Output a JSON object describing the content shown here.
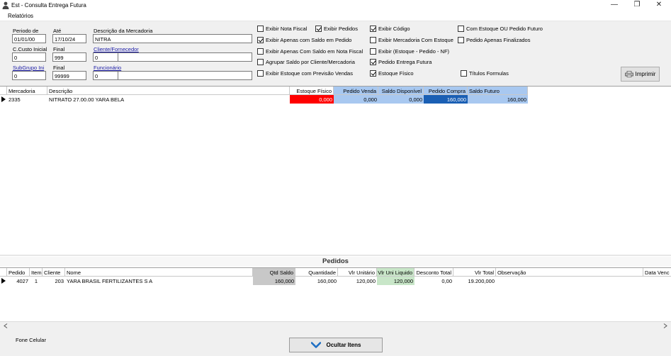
{
  "window": {
    "title": "Est - Consulta Entrega Futura",
    "minimize": "—",
    "restore": "❐",
    "close": "✕"
  },
  "menu": {
    "relatorios": "Relatórios"
  },
  "filters": {
    "periodo_de": {
      "label": "Periodo de",
      "value": "01/01/00"
    },
    "ate": {
      "label": "Até",
      "value": "17/10/24"
    },
    "descricao_mercadoria": {
      "label": "Descrição da Mercadoria",
      "value": "NITRA"
    },
    "ccusto_inicial": {
      "label": "C.Custo Inicial",
      "value": "0"
    },
    "ccusto_final": {
      "label": "Final",
      "value": "999"
    },
    "cliente_fornecedor": {
      "label": "Cliente/Fornecedor",
      "code": "0",
      "name": ""
    },
    "subgrupo_ini": {
      "label": "SubGrupo Ini",
      "value": "0"
    },
    "subgrupo_final": {
      "label": "Final",
      "value": "99999"
    },
    "funcionario": {
      "label": "Funcionário",
      "code": "0",
      "name": ""
    }
  },
  "options": {
    "exibir_nota_fiscal": {
      "label": "Exibir Nota Fiscal",
      "checked": false
    },
    "exibir_pedidos": {
      "label": "Exibir Pedidos",
      "checked": true
    },
    "exibir_codigo": {
      "label": "Exibir Código",
      "checked": true
    },
    "com_estoque_ou_pedido_futuro": {
      "label": "Com Estoque OU Pedido Futuro",
      "checked": false
    },
    "exibir_apenas_saldo_pedido": {
      "label": "Exibir Apenas com Saldo em Pedido",
      "checked": true
    },
    "exibir_mercadoria_com_estoque": {
      "label": "Exibir Mercadoria Com Estoque",
      "checked": false
    },
    "pedido_apenas_finalizados": {
      "label": "Pedido Apenas Finalizados",
      "checked": false
    },
    "exibir_apenas_saldo_nf": {
      "label": "Exibir Apenas Com Saldo em Nota Fiscal",
      "checked": false
    },
    "exibir_estoque_pedido_nf": {
      "label": "Exibir (Estoque - Pedido - NF)",
      "checked": false
    },
    "agrupar_saldo": {
      "label": "Agrupar Saldo por Cliente/Mercadoria",
      "checked": false
    },
    "pedido_entrega_futura": {
      "label": "Pedido Entrega Futura",
      "checked": true
    },
    "exibir_estoque_previsao": {
      "label": "Exibir Estoque com Previsão Vendas",
      "checked": false
    },
    "estoque_fisico": {
      "label": "Estoque Físico",
      "checked": true
    },
    "titulos_formulas": {
      "label": "Títulos Formulas",
      "checked": false
    }
  },
  "buttons": {
    "imprimir": "Imprimir",
    "ocultar_itens": "Ocultar Itens"
  },
  "grid_mercadorias": {
    "headers": {
      "mercadoria": "Mercadoria",
      "descricao": "Descrição",
      "estoque_fisico": "Estoque Físico",
      "pedido_venda": "Pedido Venda",
      "saldo_disponivel": "Saldo Disponível",
      "pedido_compra": "Pedido Compra",
      "saldo_futuro": "Saldo Futuro"
    },
    "row": {
      "mercadoria": "2335",
      "descricao": "NITRATO 27.00.00 YARA BELA",
      "estoque_fisico": "0,000",
      "pedido_venda": "0,000",
      "saldo_disponivel": "0,000",
      "pedido_compra": "160,000",
      "saldo_futuro": "160,000"
    },
    "colors": {
      "estoque_bg": "#ff0000",
      "blue_bg": "#a8c8f0",
      "selected_bg": "#1a5fb4",
      "header_blue": "#a8c8f0"
    }
  },
  "pedidos": {
    "title": "Pedidos",
    "headers": {
      "pedido": "Pedido",
      "item": "Item",
      "cliente": "Cliente",
      "nome": "Nome",
      "qtd_saldo": "Qtd Saldo",
      "quantidade": "Quantidade",
      "vlr_unitario": "Vlr Unitário",
      "vlr_uni_liquido": "Vlr Uni Liquido",
      "desconto_total": "Desconto Total",
      "vlr_total": "Vlr Total",
      "observacao": "Observação",
      "data_venc": "Data Venc"
    },
    "row": {
      "pedido": "4027",
      "item": "1",
      "cliente": "203",
      "nome": "YARA BRASIL FERTILIZANTES S A",
      "qtd_saldo": "160,000",
      "quantidade": "160,000",
      "vlr_unitario": "120,000",
      "vlr_uni_liquido": "120,000",
      "desconto_total": "0,00",
      "vlr_total": "19.200,000",
      "observacao": "",
      "data_venc": ""
    },
    "colors": {
      "qtd_bg": "#c8c8c8",
      "liquido_bg": "#c8e6c8"
    }
  },
  "footer": {
    "fone_celular": "Fone Celular"
  }
}
